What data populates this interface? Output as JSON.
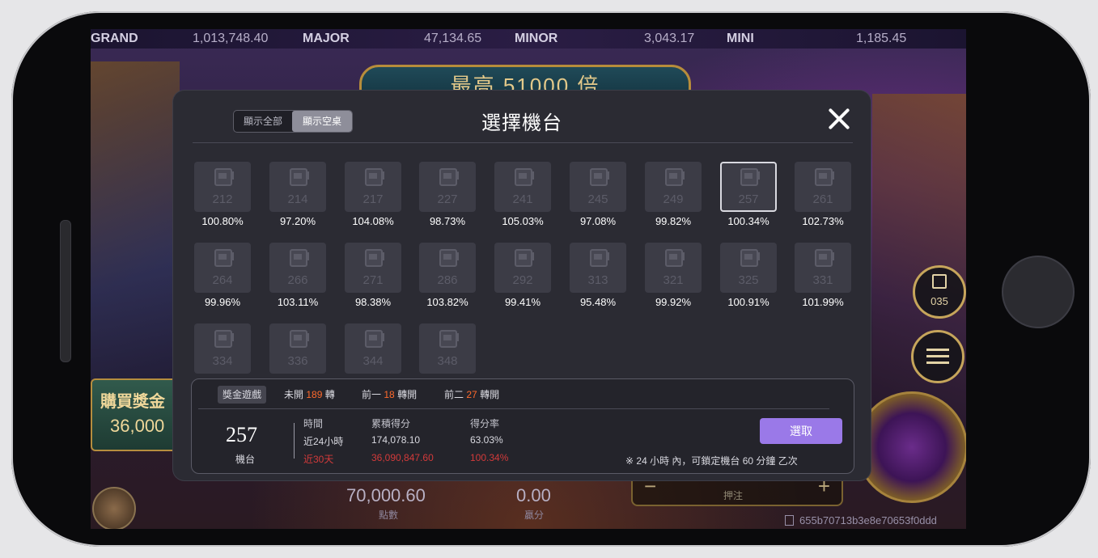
{
  "jackpots": [
    {
      "label": "GRAND",
      "value": "1,013,748.40"
    },
    {
      "label": "MAJOR",
      "value": "47,134.65"
    },
    {
      "label": "MINOR",
      "value": "3,043.17"
    },
    {
      "label": "MINI",
      "value": "1,185.45"
    }
  ],
  "game": {
    "banner": "最高 51000 倍",
    "buy_feature_label": "購買獎金",
    "buy_feature_price": "36,000",
    "balance_value": "70,000.60",
    "balance_label": "點數",
    "win_value": "0.00",
    "win_label": "贏分",
    "bet_minus": "−",
    "bet_plus": "+",
    "bet_caption": "押注",
    "machine_button_id": "035",
    "round_hash": "655b70713b3e8e70653f0ddd"
  },
  "modal": {
    "title": "選擇機台",
    "toggle": {
      "show_all": "顯示全部",
      "show_empty": "顯示空桌"
    },
    "machines": [
      {
        "id": "212",
        "rate": "100.80%"
      },
      {
        "id": "214",
        "rate": "97.20%"
      },
      {
        "id": "217",
        "rate": "104.08%"
      },
      {
        "id": "227",
        "rate": "98.73%"
      },
      {
        "id": "241",
        "rate": "105.03%"
      },
      {
        "id": "245",
        "rate": "97.08%"
      },
      {
        "id": "249",
        "rate": "99.82%"
      },
      {
        "id": "257",
        "rate": "100.34%"
      },
      {
        "id": "261",
        "rate": "102.73%"
      },
      {
        "id": "264",
        "rate": "99.96%"
      },
      {
        "id": "266",
        "rate": "103.11%"
      },
      {
        "id": "271",
        "rate": "98.38%"
      },
      {
        "id": "286",
        "rate": "103.82%"
      },
      {
        "id": "292",
        "rate": "99.41%"
      },
      {
        "id": "313",
        "rate": "95.48%"
      },
      {
        "id": "321",
        "rate": "99.92%"
      },
      {
        "id": "325",
        "rate": "100.91%"
      },
      {
        "id": "331",
        "rate": "101.99%"
      },
      {
        "id": "334",
        "rate": ""
      },
      {
        "id": "336",
        "rate": ""
      },
      {
        "id": "344",
        "rate": ""
      },
      {
        "id": "348",
        "rate": ""
      }
    ],
    "selected_machine": "257",
    "info": {
      "tabs": {
        "bonus_game": "獎金遊戲",
        "not_open_pre": "未開",
        "not_open_count": "189",
        "not_open_post": "轉",
        "prev1_pre": "前一",
        "prev1_count": "18",
        "prev1_post": "轉開",
        "prev2_pre": "前二",
        "prev2_count": "27",
        "prev2_post": "轉開"
      },
      "machine_id": "257",
      "machine_label": "機台",
      "headers": {
        "time": "時間",
        "total": "累積得分",
        "rate": "得分率"
      },
      "row24": {
        "time": "近24小時",
        "total": "174,078.10",
        "rate": "63.03%"
      },
      "row30": {
        "time": "近30天",
        "total": "36,090,847.60",
        "rate": "100.34%"
      },
      "select_button": "選取",
      "note": "※ 24 小時 內，可鎖定機台 60 分鐘 乙次"
    }
  }
}
